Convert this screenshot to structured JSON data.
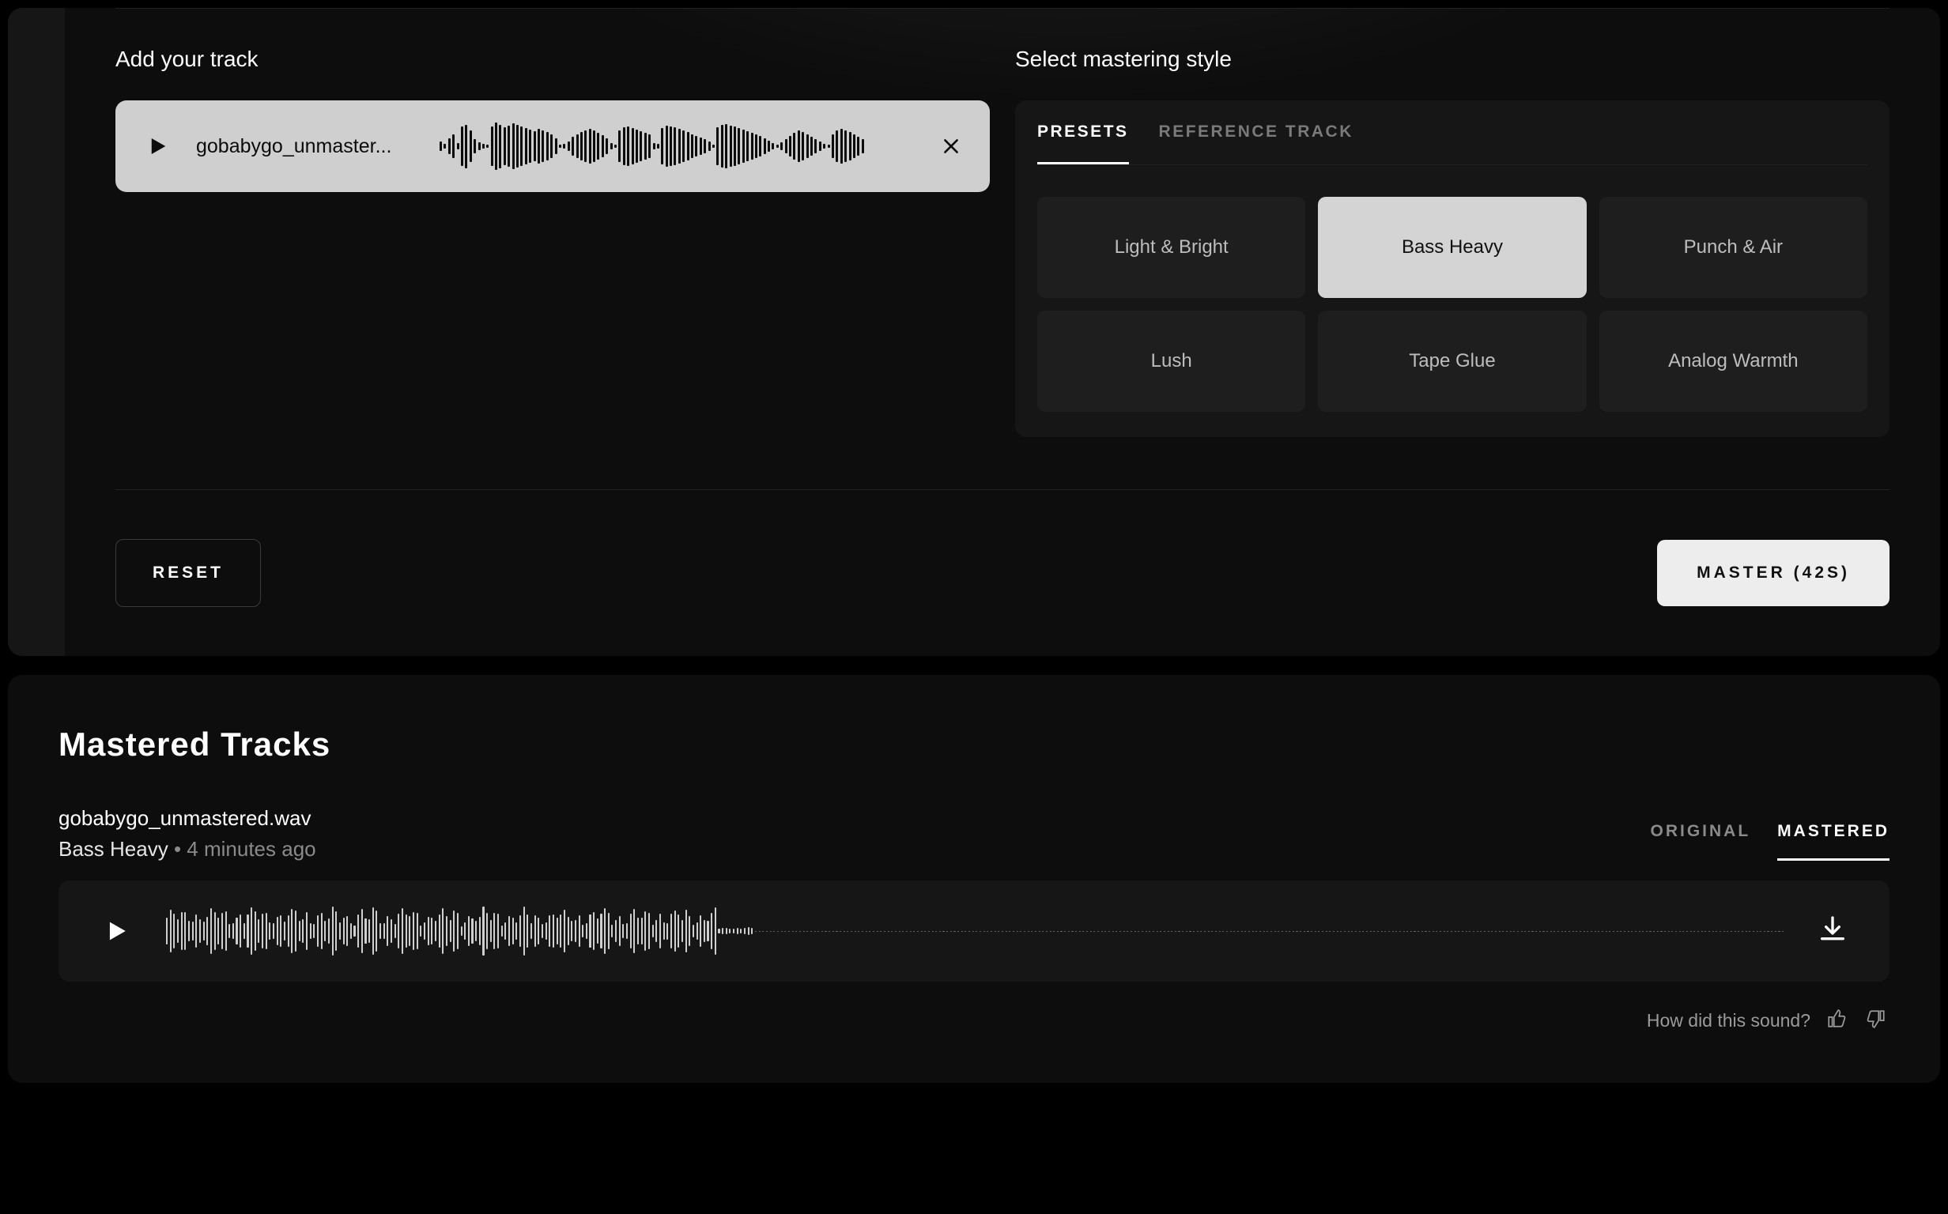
{
  "upload": {
    "title": "Add your track",
    "filename": "gobabygo_unmaster..."
  },
  "styles": {
    "title": "Select mastering style",
    "tabs": {
      "presets": "PRESETS",
      "reference": "REFERENCE TRACK"
    },
    "active_tab": "presets",
    "presets": [
      {
        "label": "Light & Bright",
        "selected": false
      },
      {
        "label": "Bass Heavy",
        "selected": true
      },
      {
        "label": "Punch & Air",
        "selected": false
      },
      {
        "label": "Lush",
        "selected": false
      },
      {
        "label": "Tape Glue",
        "selected": false
      },
      {
        "label": "Analog Warmth",
        "selected": false
      }
    ]
  },
  "actions": {
    "reset": "RESET",
    "master": "MASTER (42S)"
  },
  "results": {
    "section_title": "Mastered Tracks",
    "track": {
      "filename": "gobabygo_unmastered.wav",
      "preset": "Bass Heavy",
      "separator": " • ",
      "age": "4 minutes ago"
    },
    "tabs": {
      "original": "ORIGINAL",
      "mastered": "MASTERED"
    },
    "active_tab": "mastered",
    "feedback_prompt": "How did this sound?"
  }
}
